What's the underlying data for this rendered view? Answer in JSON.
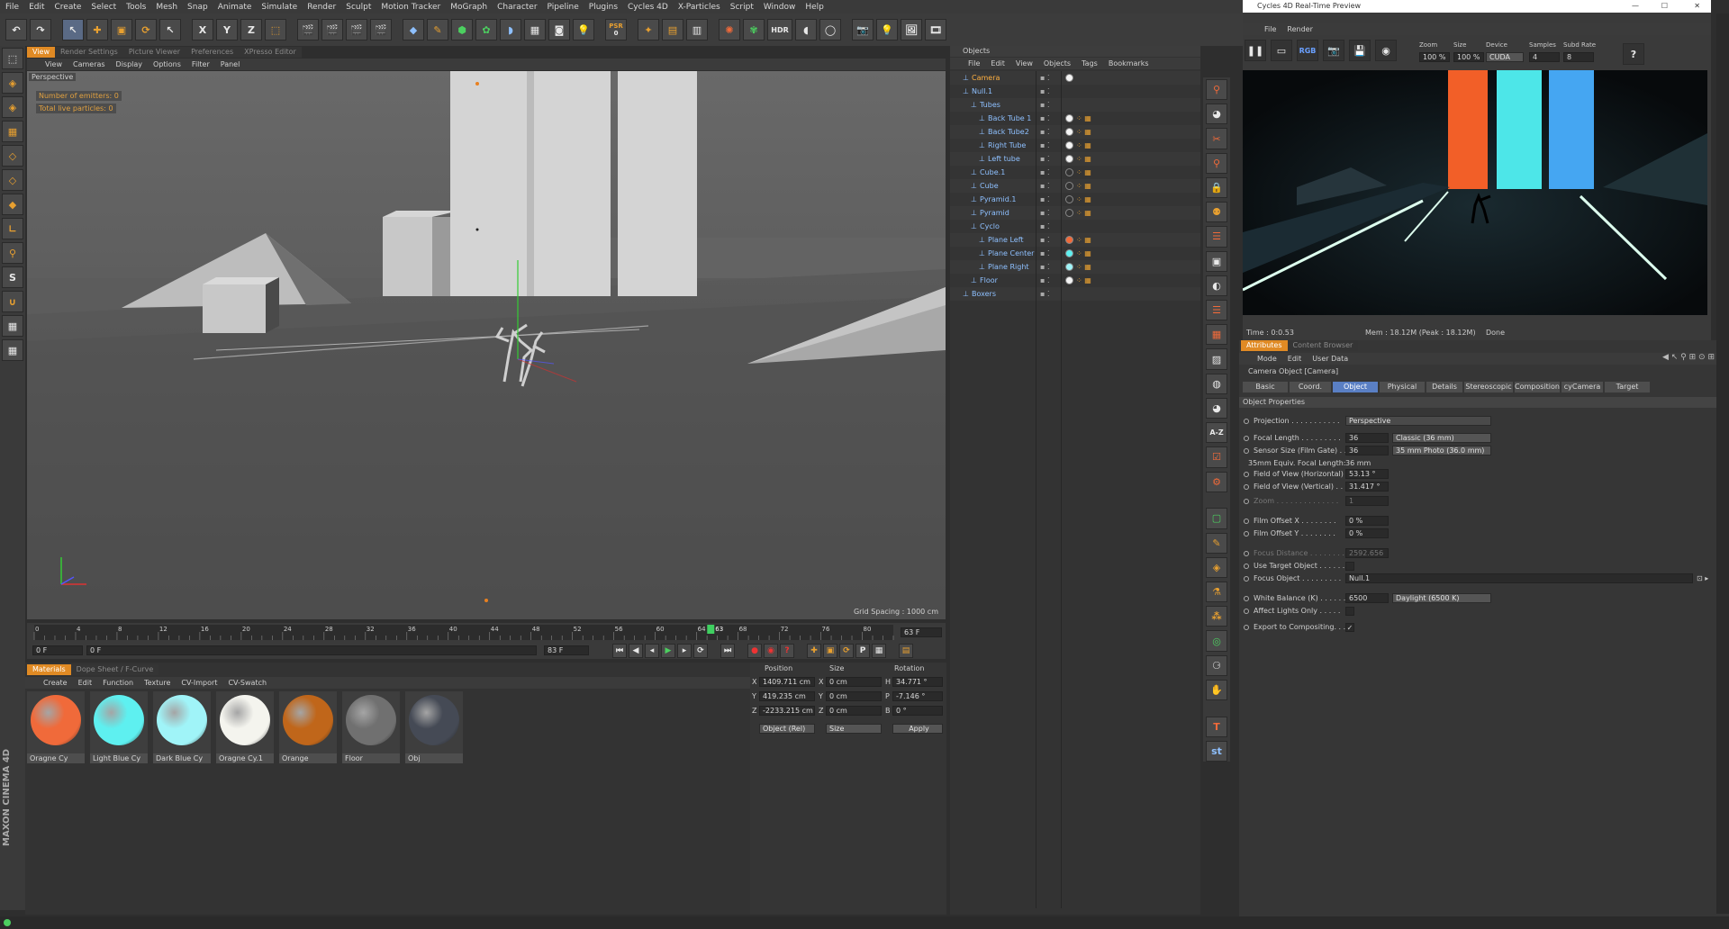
{
  "menu": [
    "File",
    "Edit",
    "Create",
    "Select",
    "Tools",
    "Mesh",
    "Snap",
    "Animate",
    "Simulate",
    "Render",
    "Sculpt",
    "Motion Tracker",
    "MoGraph",
    "Character",
    "Pipeline",
    "Plugins",
    "Cycles 4D",
    "X-Particles",
    "Script",
    "Window",
    "Help"
  ],
  "toolbar": {
    "psr_label": "PSR",
    "psr_value": "0",
    "hdr_label": "HDR"
  },
  "viewport": {
    "tabs": [
      "View",
      "Render Settings",
      "Picture Viewer",
      "Preferences",
      "XPresso Editor"
    ],
    "menu": [
      "View",
      "Cameras",
      "Display",
      "Options",
      "Filter",
      "Panel"
    ],
    "label": "Perspective",
    "emitters": "Number of emitters: 0",
    "particles": "Total live particles: 0",
    "grid_spacing": "Grid Spacing : 1000 cm"
  },
  "timeline": {
    "ticks": [
      "0",
      "4",
      "8",
      "12",
      "16",
      "20",
      "24",
      "28",
      "32",
      "36",
      "40",
      "44",
      "48",
      "52",
      "56",
      "60",
      "64",
      "68",
      "72",
      "76",
      "80"
    ],
    "current_frame": "63",
    "end_frame": "63 F",
    "start_field": "0 F",
    "min_field": "0 F",
    "max_field": "83 F",
    "end_field": "83 F",
    "playhead_fraction": 0.7875
  },
  "materials": {
    "tabs": [
      "Materials",
      "Dope Sheet / F-Curve"
    ],
    "menu": [
      "Create",
      "Edit",
      "Function",
      "Texture",
      "CV-Import",
      "CV-Swatch"
    ],
    "items": [
      {
        "name": "Oragne Cy",
        "color": "#f06a3a"
      },
      {
        "name": "Light Blue Cy",
        "color": "#5ef0f0"
      },
      {
        "name": "Dark Blue Cy",
        "color": "#a0f4f8"
      },
      {
        "name": "Oragne Cy.1",
        "color": "#f4f4ee"
      },
      {
        "name": "Orange",
        "color": "#c0661a"
      },
      {
        "name": "Floor",
        "color": "#707070"
      },
      {
        "name": "Obj",
        "color": "#454a55"
      }
    ]
  },
  "coords": {
    "headers": [
      "Position",
      "Size",
      "Rotation"
    ],
    "rows": [
      {
        "axis": "X",
        "pos": "1409.711 cm",
        "size": "0 cm",
        "raxis": "H",
        "rot": "34.771 °"
      },
      {
        "axis": "Y",
        "pos": "419.235 cm",
        "size": "0 cm",
        "raxis": "P",
        "rot": "-7.146 °"
      },
      {
        "axis": "Z",
        "pos": "-2233.215 cm",
        "size": "0 cm",
        "raxis": "B",
        "rot": "0 °"
      }
    ],
    "mode1": "Object (Rel)",
    "mode2": "Size",
    "apply": "Apply"
  },
  "objects": {
    "title": "Objects",
    "menu": [
      "File",
      "Edit",
      "View",
      "Objects",
      "Tags",
      "Bookmarks"
    ],
    "rows": [
      {
        "name": "Camera",
        "indent": 0,
        "selected": true
      },
      {
        "name": "Null.1",
        "indent": 0,
        "selected": false
      },
      {
        "name": "Tubes",
        "indent": 1,
        "selected": false
      },
      {
        "name": "Back Tube 1",
        "indent": 2,
        "selected": false
      },
      {
        "name": "Back Tube2",
        "indent": 2,
        "selected": false
      },
      {
        "name": "Right Tube",
        "indent": 2,
        "selected": false
      },
      {
        "name": "Left tube",
        "indent": 2,
        "selected": false
      },
      {
        "name": "Cube.1",
        "indent": 1,
        "selected": false
      },
      {
        "name": "Cube",
        "indent": 1,
        "selected": false
      },
      {
        "name": "Pyramid.1",
        "indent": 1,
        "selected": false
      },
      {
        "name": "Pyramid",
        "indent": 1,
        "selected": false
      },
      {
        "name": "Cyclo",
        "indent": 1,
        "selected": false
      },
      {
        "name": "Plane Left",
        "indent": 2,
        "selected": false
      },
      {
        "name": "Plane Center",
        "indent": 2,
        "selected": false
      },
      {
        "name": "Plane Right",
        "indent": 2,
        "selected": false
      },
      {
        "name": "Floor",
        "indent": 1,
        "selected": false
      },
      {
        "name": "Boxers",
        "indent": 0,
        "selected": false
      }
    ]
  },
  "preview": {
    "title": "Cycles 4D Real-Time Preview",
    "menu": [
      "File",
      "Render"
    ],
    "labels": {
      "zoom": "Zoom",
      "size": "Size",
      "device": "Device",
      "samples": "Samples",
      "subd": "Subd Rate"
    },
    "values": {
      "zoom": "100 %",
      "size": "100 %",
      "device": "CUDA",
      "samples": "4",
      "subd": "8"
    },
    "rgb": "RGB",
    "time": "Time : 0:0.53",
    "mem": "Mem : 18.12M (Peak : 18.12M)",
    "status": "Done"
  },
  "attributes": {
    "tabs": [
      "Attributes",
      "Content Browser"
    ],
    "menu": [
      "Mode",
      "Edit",
      "User Data"
    ],
    "object": "Camera Object [Camera]",
    "subtabs": [
      "Basic",
      "Coord.",
      "Object",
      "Physical",
      "Details",
      "Stereoscopic",
      "Composition",
      "cyCamera",
      "Target"
    ],
    "section": "Object Properties",
    "rows": [
      {
        "label": "Projection . . . . . . . . . . .",
        "value": "Perspective",
        "kind": "dd"
      },
      {
        "label": "Focal Length . . . . . . . . .",
        "value": "36",
        "extra": "Classic (36 mm)",
        "kind": "num"
      },
      {
        "label": "Sensor Size (Film Gate) . .",
        "value": "36",
        "extra": "35 mm Photo (36.0 mm)",
        "kind": "num"
      },
      {
        "label": "35mm Equiv. Focal Length:",
        "value": "36 mm",
        "kind": "text"
      },
      {
        "label": "Field of View (Horizontal)",
        "value": "53.13 °",
        "kind": "num"
      },
      {
        "label": "Field of View (Vertical) . .",
        "value": "31.417 °",
        "kind": "num"
      },
      {
        "label": "Zoom . . . . . . . . . . . . . .",
        "value": "1",
        "kind": "dimnum"
      },
      {
        "label": "Film Offset X . . . . . . . .",
        "value": "0 %",
        "kind": "num"
      },
      {
        "label": "Film Offset Y . . . . . . . .",
        "value": "0 %",
        "kind": "num"
      },
      {
        "label": "Focus Distance . . . . . . . .",
        "value": "2592.656",
        "kind": "dimnum"
      },
      {
        "label": "Use Target Object . . . . . .",
        "value": "",
        "kind": "check"
      },
      {
        "label": "Focus Object . . . . . . . . .",
        "value": "Null.1",
        "kind": "link"
      },
      {
        "label": "White Balance (K) . . . . . .",
        "value": "6500",
        "extra": "Daylight (6500 K)",
        "kind": "num"
      },
      {
        "label": "Affect Lights Only . . . . .",
        "value": "",
        "kind": "check"
      },
      {
        "label": "Export to Compositing. . . .",
        "value": "✓",
        "kind": "check"
      }
    ]
  },
  "brand": "MAXON CINEMA 4D"
}
